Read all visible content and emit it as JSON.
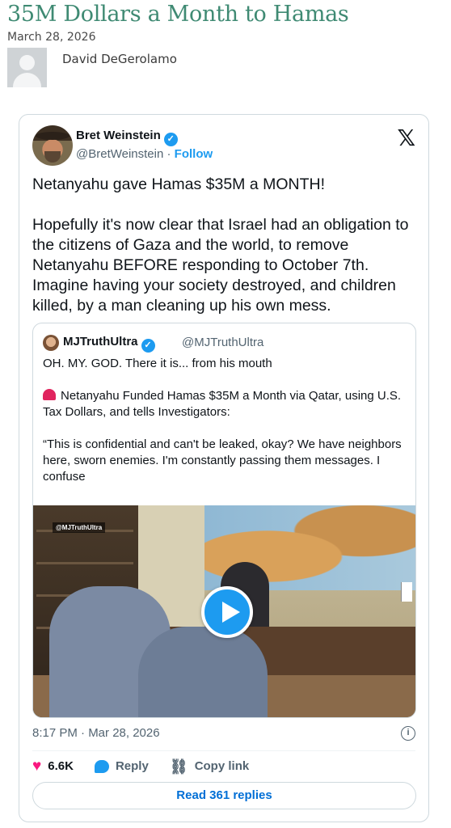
{
  "article": {
    "title": "35M Dollars a Month to Hamas",
    "date": "March 28, 2026",
    "author": "David DeGerolamo"
  },
  "tweet": {
    "name": "Bret Weinstein",
    "handle": "@BretWeinstein",
    "separator": "·",
    "follow_label": "Follow",
    "x_logo": "𝕏",
    "paragraphs": [
      "Netanyahu gave Hamas $35M a MONTH!",
      "Hopefully it's now clear that Israel had an obligation to the citizens of Gaza and the world, to remove Netanyahu BEFORE responding to October 7th. Imagine having your society destroyed, and children killed, by a man cleaning up his own mess."
    ],
    "timestamp": "8:17 PM · Mar 28, 2026",
    "info_icon": "i",
    "likes": "6.6K",
    "reply_label": "Reply",
    "copy_link_label": "Copy link",
    "read_replies_label": "Read 361 replies",
    "icons": {
      "heart": "heart-icon",
      "reply": "reply-icon",
      "link": "link-icon",
      "verified": "verified-icon",
      "info": "info-icon",
      "play": "play-icon"
    },
    "colors": {
      "accent": "#1d9bf0",
      "like": "#f91880",
      "title_green": "#3f8a73"
    }
  },
  "quote": {
    "name": "MJTruthUltra",
    "handle": "@MJTruthUltra",
    "line1": "OH. MY. GOD. There it is... from his mouth",
    "line2": "Netanyahu Funded Hamas $35M a Month via Qatar, using U.S. Tax Dollars, and tells Investigators:",
    "line3": "“This is confidential and can't be leaked, okay? We have neighbors here, sworn enemies. I'm constantly passing them messages. I confuse",
    "video_watermark": "@MJTruthUltra"
  }
}
